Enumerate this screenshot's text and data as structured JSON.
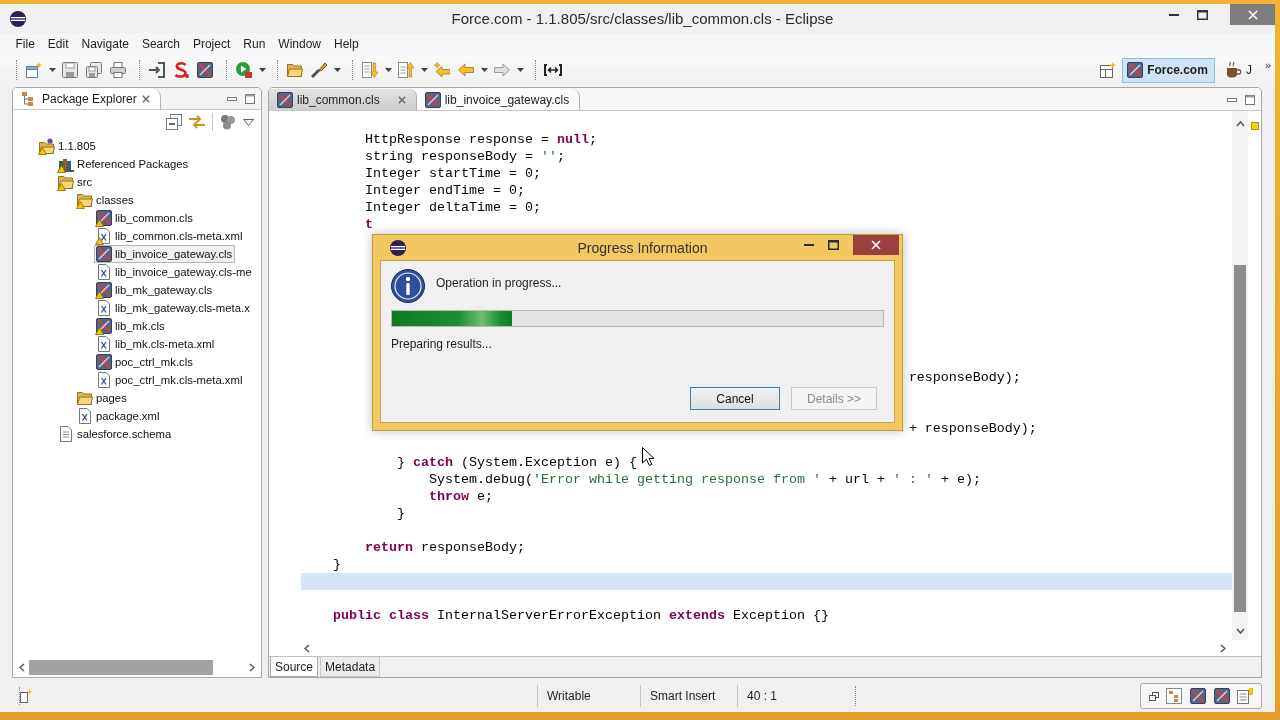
{
  "window": {
    "title": "Force.com - 1.1.805/src/classes/lib_common.cls - Eclipse"
  },
  "menu_bar": [
    "File",
    "Edit",
    "Navigate",
    "Search",
    "Project",
    "Run",
    "Window",
    "Help"
  ],
  "perspectives": {
    "items": [
      {
        "label": "Force.com",
        "kind": "apex",
        "selected": true
      },
      {
        "label": "J",
        "kind": "java",
        "selected": false
      }
    ],
    "overflow": "»"
  },
  "package_explorer": {
    "title": "Package Explorer",
    "tree": [
      {
        "label": "1.1.805",
        "kind": "project",
        "warning": true,
        "selected": false,
        "children": [
          {
            "label": "Referenced Packages",
            "kind": "library",
            "warning": true,
            "selected": false
          },
          {
            "label": "src",
            "kind": "folder",
            "warning": true,
            "selected": false,
            "children": [
              {
                "label": "classes",
                "kind": "folder",
                "warning": true,
                "selected": false,
                "children": [
                  {
                    "label": "lib_common.cls",
                    "kind": "apex-class",
                    "warning": true,
                    "selected": false
                  },
                  {
                    "label": "lib_common.cls-meta.xml",
                    "kind": "xml-file",
                    "warning": true,
                    "selected": false
                  },
                  {
                    "label": "lib_invoice_gateway.cls",
                    "kind": "apex-class",
                    "warning": false,
                    "selected": true
                  },
                  {
                    "label": "lib_invoice_gateway.cls-me",
                    "kind": "xml-file",
                    "warning": false,
                    "selected": false
                  },
                  {
                    "label": "lib_mk_gateway.cls",
                    "kind": "apex-class",
                    "warning": true,
                    "selected": false
                  },
                  {
                    "label": "lib_mk_gateway.cls-meta.x",
                    "kind": "xml-file",
                    "warning": false,
                    "selected": false
                  },
                  {
                    "label": "lib_mk.cls",
                    "kind": "apex-class",
                    "warning": true,
                    "selected": false
                  },
                  {
                    "label": "lib_mk.cls-meta.xml",
                    "kind": "xml-file",
                    "warning": false,
                    "selected": false
                  },
                  {
                    "label": "poc_ctrl_mk.cls",
                    "kind": "apex-class",
                    "warning": false,
                    "selected": false
                  },
                  {
                    "label": "poc_ctrl_mk.cls-meta.xml",
                    "kind": "xml-file",
                    "warning": false,
                    "selected": false
                  }
                ]
              },
              {
                "label": "pages",
                "kind": "folder",
                "warning": false,
                "selected": false
              },
              {
                "label": "package.xml",
                "kind": "xml-file",
                "warning": false,
                "selected": false
              }
            ]
          },
          {
            "label": "salesforce.schema",
            "kind": "schema-file",
            "warning": false,
            "selected": false
          }
        ]
      }
    ]
  },
  "editor": {
    "tabs": [
      {
        "label": "lib_common.cls",
        "selected": true
      },
      {
        "label": "lib_invoice_gateway.cls",
        "selected": false
      }
    ],
    "lines": [
      {
        "segments": [
          {
            "text": "        HttpResponse response = ",
            "kind": "plain"
          },
          {
            "text": "null",
            "kind": "keyword"
          },
          {
            "text": ";",
            "kind": "plain"
          }
        ],
        "current": false
      },
      {
        "segments": [
          {
            "text": "        string responseBody = ",
            "kind": "plain"
          },
          {
            "text": "''",
            "kind": "string"
          },
          {
            "text": ";",
            "kind": "plain"
          }
        ],
        "current": false
      },
      {
        "segments": [
          {
            "text": "        Integer startTime = 0;",
            "kind": "plain"
          }
        ],
        "current": false
      },
      {
        "segments": [
          {
            "text": "        Integer endTime = 0;",
            "kind": "plain"
          }
        ],
        "current": false
      },
      {
        "segments": [
          {
            "text": "        Integer deltaTime = 0;",
            "kind": "plain"
          }
        ],
        "current": false
      },
      {
        "segments": [
          {
            "text": "        t",
            "kind": "keyword"
          }
        ],
        "current": false
      },
      {
        "current": false
      },
      {
        "current": false
      },
      {
        "current": false
      },
      {
        "current": false
      },
      {
        "current": false
      },
      {
        "current": false
      },
      {
        "current": false
      },
      {
        "current": false
      },
      {
        "segments": [
          {
            "text": "                                                                            responseBody);",
            "kind": "plain"
          }
        ],
        "current": false
      },
      {
        "current": false
      },
      {
        "current": false
      },
      {
        "segments": [
          {
            "text": "                                                                            + responseBody);",
            "kind": "plain"
          }
        ],
        "current": false
      },
      {
        "current": false
      },
      {
        "segments": [
          {
            "text": "            } ",
            "kind": "plain"
          },
          {
            "text": "catch",
            "kind": "keyword"
          },
          {
            "text": " (System.Exception e) {",
            "kind": "plain"
          }
        ],
        "current": false
      },
      {
        "segments": [
          {
            "text": "                System.debug(",
            "kind": "plain"
          },
          {
            "text": "'Error while getting response from '",
            "kind": "string"
          },
          {
            "text": " + url + ",
            "kind": "plain"
          },
          {
            "text": "' : '",
            "kind": "string"
          },
          {
            "text": " + e);",
            "kind": "plain"
          }
        ],
        "current": false
      },
      {
        "segments": [
          {
            "text": "                throw",
            "kind": "keyword"
          },
          {
            "text": " e;",
            "kind": "plain"
          }
        ],
        "current": false
      },
      {
        "segments": [
          {
            "text": "            }",
            "kind": "plain"
          }
        ],
        "current": false
      },
      {
        "current": false
      },
      {
        "segments": [
          {
            "text": "        return",
            "kind": "keyword"
          },
          {
            "text": " responseBody;",
            "kind": "plain"
          }
        ],
        "current": false
      },
      {
        "segments": [
          {
            "text": "    }",
            "kind": "plain"
          }
        ],
        "current": false
      },
      {
        "current": true
      },
      {
        "current": false
      },
      {
        "segments": [
          {
            "text": "    public class",
            "kind": "keyword"
          },
          {
            "text": " InternalServerErrorException ",
            "kind": "plain"
          },
          {
            "text": "extends",
            "kind": "keyword"
          },
          {
            "text": " Exception {}",
            "kind": "plain"
          }
        ],
        "current": false
      }
    ],
    "bottom_tabs": [
      {
        "label": "Source",
        "selected": true
      },
      {
        "label": "Metadata",
        "selected": false
      }
    ]
  },
  "progress_dialog": {
    "title": "Progress Information",
    "message": "Operation in progress...",
    "level": 0.245,
    "status": "Preparing results...",
    "buttons": [
      {
        "label": "Cancel",
        "focused": true,
        "disabled": false
      },
      {
        "label": "Details >>",
        "focused": false,
        "disabled": true
      }
    ]
  },
  "status_bar": {
    "fields": [
      "Writable",
      "Smart Insert",
      "40 : 1"
    ]
  }
}
